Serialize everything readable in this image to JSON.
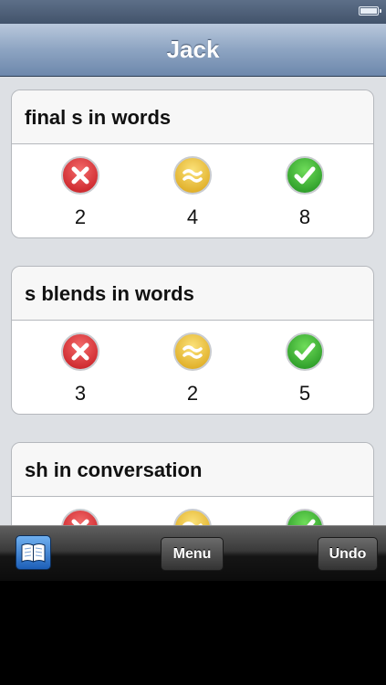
{
  "nav": {
    "title": "Jack"
  },
  "cards": [
    {
      "title": "final s in words",
      "incorrect": "2",
      "approximate": "4",
      "correct": "8"
    },
    {
      "title": "s blends in words",
      "incorrect": "3",
      "approximate": "2",
      "correct": "5"
    },
    {
      "title": "sh in conversation",
      "incorrect": "",
      "approximate": "",
      "correct": ""
    }
  ],
  "icons": {
    "incorrect": "x-circle-icon",
    "approximate": "approx-circle-icon",
    "correct": "check-circle-icon",
    "book": "book-icon",
    "battery": "battery-icon"
  },
  "colors": {
    "incorrect": "#d8222a",
    "approximate": "#e6b41d",
    "correct": "#2aa52a",
    "nav_bar": "#8da4c2"
  },
  "toolbar": {
    "menu_label": "Menu",
    "undo_label": "Undo"
  }
}
